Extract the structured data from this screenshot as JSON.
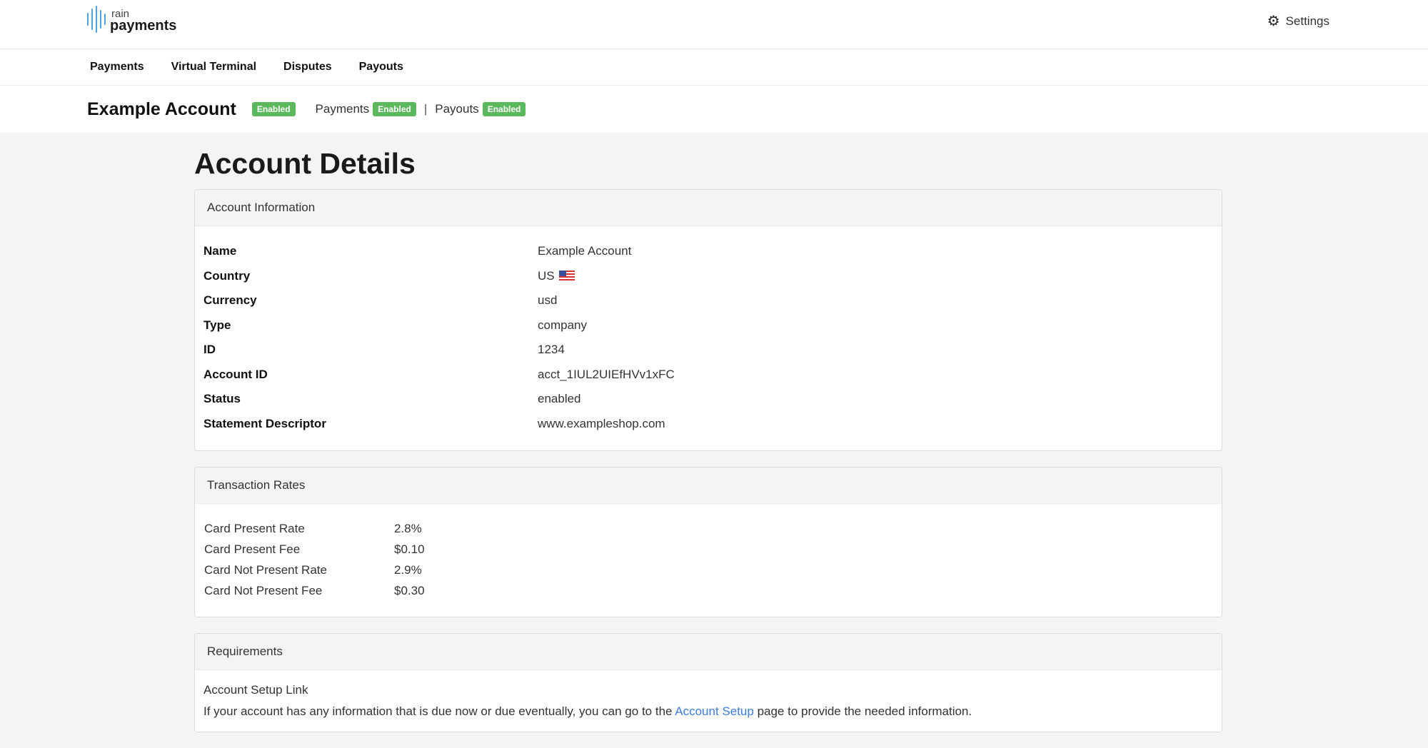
{
  "brand": {
    "small": "rain",
    "big": "payments"
  },
  "header": {
    "settings_label": "Settings",
    "settings_icon": "gear-icon"
  },
  "nav": {
    "items": [
      "Payments",
      "Virtual Terminal",
      "Disputes",
      "Payouts"
    ]
  },
  "account_bar": {
    "name": "Example Account",
    "status_badge": "Enabled",
    "payments_label": "Payments",
    "payments_badge": "Enabled",
    "separator": "|",
    "payouts_label": "Payouts",
    "payouts_badge": "Enabled"
  },
  "page": {
    "title": "Account Details"
  },
  "account_information": {
    "heading": "Account Information",
    "rows": [
      {
        "label": "Name",
        "value": "Example Account"
      },
      {
        "label": "Country",
        "value": "US"
      },
      {
        "label": "Currency",
        "value": "usd"
      },
      {
        "label": "Type",
        "value": "company"
      },
      {
        "label": "ID",
        "value": "1234"
      },
      {
        "label": "Account ID",
        "value": "acct_1IUL2UIEfHVv1xFC"
      },
      {
        "label": "Status",
        "value": "enabled"
      },
      {
        "label": "Statement Descriptor",
        "value": "www.exampleshop.com"
      }
    ]
  },
  "transaction_rates": {
    "heading": "Transaction Rates",
    "rows": [
      {
        "label": "Card Present Rate",
        "value": "2.8%"
      },
      {
        "label": "Card Present Fee",
        "value": "$0.10"
      },
      {
        "label": "Card Not Present Rate",
        "value": "2.9%"
      },
      {
        "label": "Card Not Present Fee",
        "value": "$0.30"
      }
    ]
  },
  "requirements": {
    "heading": "Requirements",
    "title": "Account Setup Link",
    "text_before": "If your account has any information that is due now or due eventually, you can go to the ",
    "link_text": "Account Setup",
    "text_after": " page to provide the needed information."
  },
  "colors": {
    "accent": "#3b7ddd",
    "badge": "#5cb85c",
    "logo": "#4fa3d8"
  }
}
